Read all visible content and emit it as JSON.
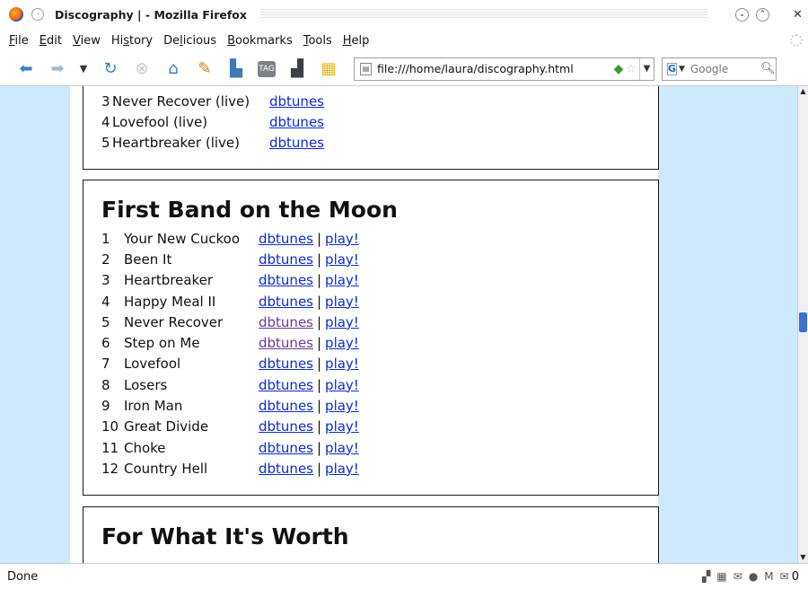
{
  "window": {
    "title": "Discography | - Mozilla Firefox"
  },
  "menu": [
    "File",
    "Edit",
    "View",
    "History",
    "Delicious",
    "Bookmarks",
    "Tools",
    "Help"
  ],
  "urlbar": {
    "url": "file:///home/laura/discography.html"
  },
  "search": {
    "placeholder": "Google"
  },
  "albums": [
    {
      "title": "",
      "tracks": [
        {
          "num": "3",
          "name": "Never Recover (live)",
          "links": [
            {
              "label": "dbtunes",
              "visited": false
            }
          ]
        },
        {
          "num": "4",
          "name": "Lovefool (live)",
          "links": [
            {
              "label": "dbtunes",
              "visited": false
            }
          ]
        },
        {
          "num": "5",
          "name": "Heartbreaker (live)",
          "links": [
            {
              "label": "dbtunes",
              "visited": false
            }
          ]
        }
      ]
    },
    {
      "title": "First Band on the Moon",
      "tracks": [
        {
          "num": "1",
          "name": "Your New Cuckoo",
          "links": [
            {
              "label": "dbtunes",
              "visited": false
            },
            {
              "label": "play!",
              "visited": false
            }
          ]
        },
        {
          "num": "2",
          "name": "Been It",
          "links": [
            {
              "label": "dbtunes",
              "visited": false
            },
            {
              "label": "play!",
              "visited": false
            }
          ]
        },
        {
          "num": "3",
          "name": "Heartbreaker",
          "links": [
            {
              "label": "dbtunes",
              "visited": false
            },
            {
              "label": "play!",
              "visited": false
            }
          ]
        },
        {
          "num": "4",
          "name": "Happy Meal II",
          "links": [
            {
              "label": "dbtunes",
              "visited": false
            },
            {
              "label": "play!",
              "visited": false
            }
          ]
        },
        {
          "num": "5",
          "name": "Never Recover",
          "links": [
            {
              "label": "dbtunes",
              "visited": true
            },
            {
              "label": "play!",
              "visited": false
            }
          ]
        },
        {
          "num": "6",
          "name": "Step on Me",
          "links": [
            {
              "label": "dbtunes",
              "visited": true
            },
            {
              "label": "play!",
              "visited": false
            }
          ]
        },
        {
          "num": "7",
          "name": "Lovefool",
          "links": [
            {
              "label": "dbtunes",
              "visited": false
            },
            {
              "label": "play!",
              "visited": false
            }
          ]
        },
        {
          "num": "8",
          "name": "Losers",
          "links": [
            {
              "label": "dbtunes",
              "visited": false
            },
            {
              "label": "play!",
              "visited": false
            }
          ]
        },
        {
          "num": "9",
          "name": "Iron Man",
          "links": [
            {
              "label": "dbtunes",
              "visited": false
            },
            {
              "label": "play!",
              "visited": false
            }
          ]
        },
        {
          "num": "10",
          "name": "Great Divide",
          "links": [
            {
              "label": "dbtunes",
              "visited": false
            },
            {
              "label": "play!",
              "visited": false
            }
          ]
        },
        {
          "num": "11",
          "name": "Choke",
          "links": [
            {
              "label": "dbtunes",
              "visited": false
            },
            {
              "label": "play!",
              "visited": false
            }
          ]
        },
        {
          "num": "12",
          "name": "Country Hell",
          "links": [
            {
              "label": "dbtunes",
              "visited": false
            },
            {
              "label": "play!",
              "visited": false
            }
          ]
        }
      ]
    },
    {
      "title": "For What It's Worth",
      "tracks": []
    }
  ],
  "statusbar": {
    "status": "Done",
    "mail_count": "0"
  },
  "colors": {
    "link": "#0b2bd6",
    "visited_link": "#6b3a9c",
    "page_background": "#cde9fb"
  }
}
